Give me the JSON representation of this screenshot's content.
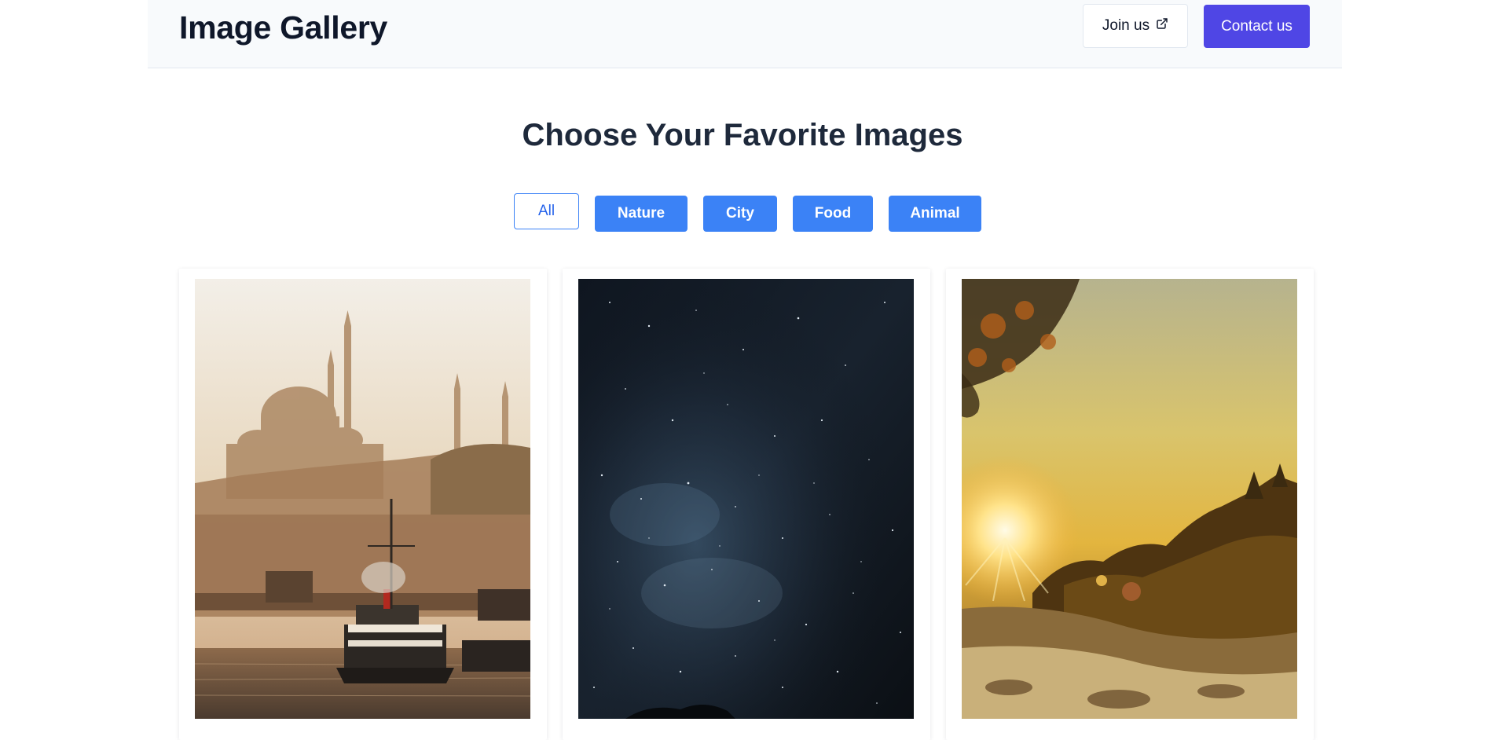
{
  "header": {
    "brand": "Image Gallery",
    "join_label": "Join us",
    "contact_label": "Contact us"
  },
  "main": {
    "title": "Choose Your Favorite Images",
    "filters": [
      {
        "label": "All",
        "active": true
      },
      {
        "label": "Nature",
        "active": false
      },
      {
        "label": "City",
        "active": false
      },
      {
        "label": "Food",
        "active": false
      },
      {
        "label": "Animal",
        "active": false
      }
    ],
    "images": [
      {
        "subject": "istanbul-mosque-ferry"
      },
      {
        "subject": "starry-night-sky"
      },
      {
        "subject": "sunset-forest"
      }
    ]
  },
  "icons": {
    "join": "external-link-icon"
  },
  "colors": {
    "accent": "#4f46e5",
    "filter": "#3b82f6",
    "header_bg": "#f8fafc"
  }
}
